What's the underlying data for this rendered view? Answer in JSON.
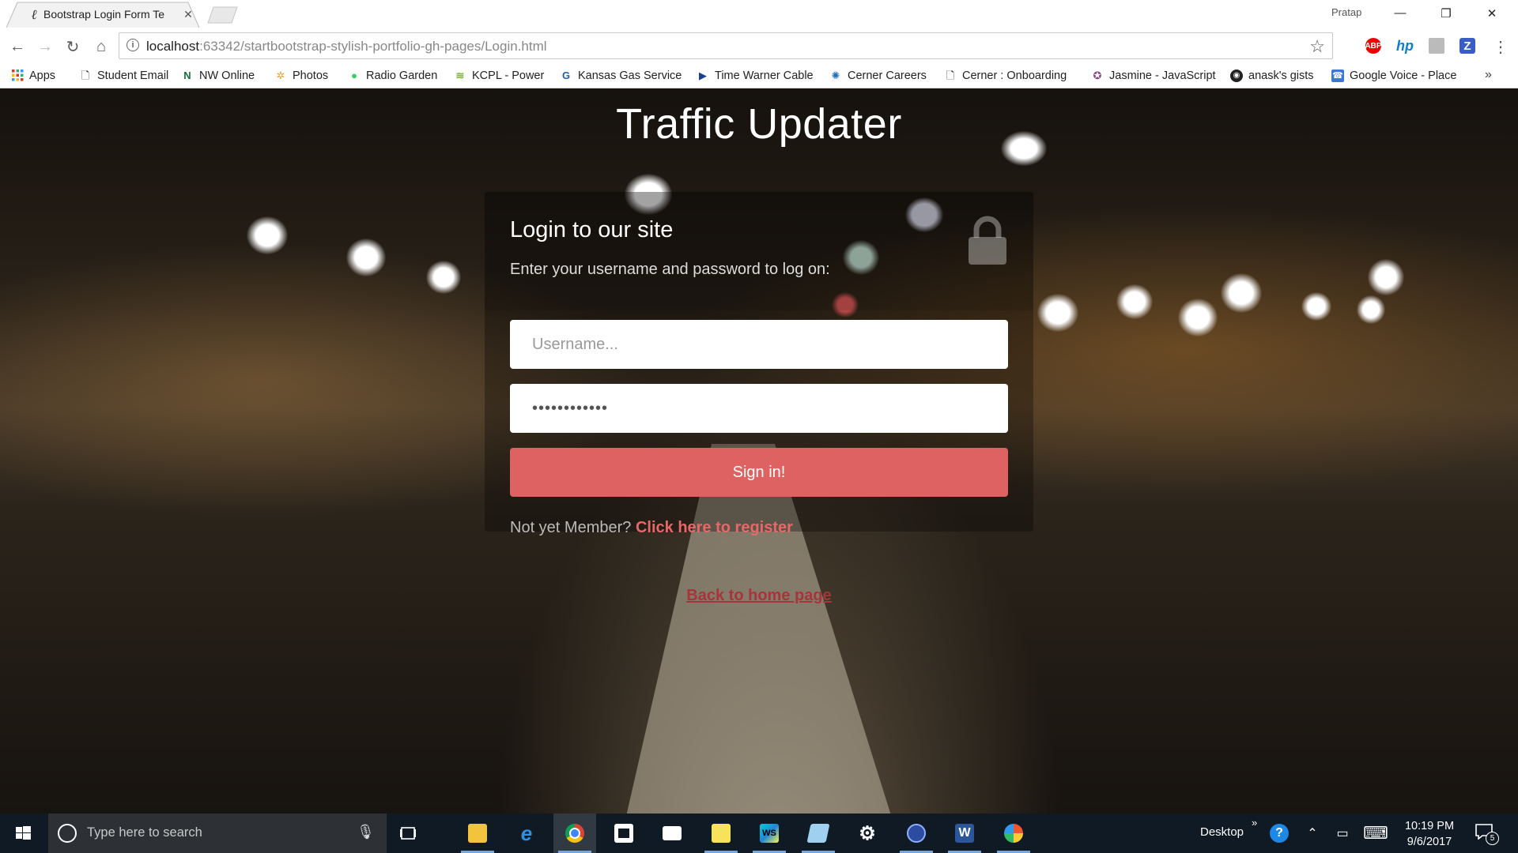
{
  "browser": {
    "tab_title": "Bootstrap Login Form Te",
    "profile_name": "Pratap",
    "url_host": "localhost",
    "url_rest": ":63342/startbootstrap-stylish-portfolio-gh-pages/Login.html",
    "extensions": [
      "abp-icon",
      "hp-icon",
      "ghost-extension-icon",
      "z-extension-icon"
    ],
    "ext_abp_label": "ABP",
    "ext_hp_label": "hp",
    "ext_z_label": "Z"
  },
  "bookmarks": [
    {
      "label": "Apps",
      "icon": "apps-grid-icon"
    },
    {
      "label": "Student Email",
      "icon": "page-icon"
    },
    {
      "label": "NW Online",
      "icon": "nw-icon"
    },
    {
      "label": "Photos",
      "icon": "photos-icon"
    },
    {
      "label": "Radio Garden",
      "icon": "green-dot-icon"
    },
    {
      "label": "KCPL - Power",
      "icon": "kcpl-icon"
    },
    {
      "label": "Kansas Gas Service",
      "icon": "gas-icon"
    },
    {
      "label": "Time Warner Cable",
      "icon": "play-icon"
    },
    {
      "label": "Cerner Careers",
      "icon": "cerner-icon"
    },
    {
      "label": "Cerner : Onboarding",
      "icon": "page-icon"
    },
    {
      "label": "Jasmine - JavaScript",
      "icon": "jasmine-icon"
    },
    {
      "label": "anask's gists",
      "icon": "github-icon"
    },
    {
      "label": "Google Voice - Place",
      "icon": "voice-icon"
    }
  ],
  "page": {
    "site_title": "Traffic Updater",
    "login_heading": "Login to our site",
    "login_subtitle": "Enter your username and password to log on:",
    "username_placeholder": "Username...",
    "password_value": "••••••••••••",
    "signin_label": "Sign in!",
    "register_prompt": "Not yet Member? ",
    "register_link": "Click here to register",
    "home_link": "Back to home page"
  },
  "taskbar": {
    "search_placeholder": "Type here to search",
    "desktop_label": "Desktop",
    "time": "10:19 PM",
    "date": "9/6/2017",
    "notification_count": "5",
    "word_label": "W",
    "webstorm_label": "WS"
  },
  "colors": {
    "accent": "#de6262",
    "link": "#e8686a",
    "taskbar": "#101a24"
  }
}
